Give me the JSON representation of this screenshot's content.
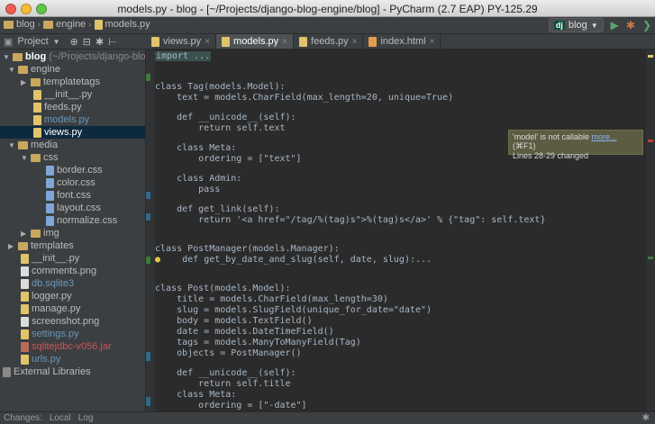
{
  "window": {
    "title": "models.py - blog - [~/Projects/django-blog-engine/blog] - PyCharm (2.7 EAP) PY-125.29"
  },
  "breadcrumbs": [
    "blog",
    "engine",
    "models.py"
  ],
  "run_config": {
    "label": "blog",
    "badge": "dj"
  },
  "project_panel": {
    "label": "Project"
  },
  "tabs": [
    {
      "label": "views.py",
      "icon": "python-file-icon"
    },
    {
      "label": "models.py",
      "icon": "python-file-icon",
      "active": true
    },
    {
      "label": "feeds.py",
      "icon": "python-file-icon"
    },
    {
      "label": "index.html",
      "icon": "html-file-icon"
    }
  ],
  "tree": [
    {
      "label": "blog",
      "path": "(~/Projects/django-blog",
      "type": "root"
    },
    {
      "label": "engine",
      "type": "folder",
      "open": true
    },
    {
      "label": "templatetags",
      "type": "folder"
    },
    {
      "label": "__init__.py",
      "type": "py"
    },
    {
      "label": "feeds.py",
      "type": "py"
    },
    {
      "label": "models.py",
      "type": "py"
    },
    {
      "label": "views.py",
      "type": "py",
      "selected": true
    },
    {
      "label": "media",
      "type": "folder",
      "open": true
    },
    {
      "label": "css",
      "type": "folder",
      "open": true
    },
    {
      "label": "border.css",
      "type": "css"
    },
    {
      "label": "color.css",
      "type": "css"
    },
    {
      "label": "font.css",
      "type": "css"
    },
    {
      "label": "layout.css",
      "type": "css"
    },
    {
      "label": "normalize.css",
      "type": "css"
    },
    {
      "label": "img",
      "type": "folder"
    },
    {
      "label": "templates",
      "type": "folder"
    },
    {
      "label": "__init__.py",
      "type": "py"
    },
    {
      "label": "comments.png",
      "type": "img"
    },
    {
      "label": "db.sqlite3",
      "type": "db"
    },
    {
      "label": "logger.py",
      "type": "py"
    },
    {
      "label": "manage.py",
      "type": "py"
    },
    {
      "label": "screenshot.png",
      "type": "img"
    },
    {
      "label": "settings.py",
      "type": "py"
    },
    {
      "label": "sqlitejdbc-v056.jar",
      "type": "jar"
    },
    {
      "label": "urls.py",
      "type": "py"
    },
    {
      "label": "External Libraries",
      "type": "lib"
    }
  ],
  "code": [
    "import ...",
    "",
    "",
    "class Tag(models.Model):",
    "    text = models.CharField(max_length=20, unique=True)",
    "",
    "    def __unicode__(self):",
    "        return self.text",
    "",
    "    class Meta:",
    "        ordering = [\"text\"]",
    "",
    "    class Admin:",
    "        pass",
    "",
    "    def get_link(self):",
    "        return '<a href=\"/tag/%(tag)s\">%(tag)s</a>' % {\"tag\": self.text}",
    "",
    "",
    "class PostManager(models.Manager):",
    "    def get_by_date_and_slug(self, date, slug):...",
    "",
    "",
    "class Post(models.Model):",
    "    title = models.CharField(max_length=30)",
    "    slug = models.SlugField(unique_for_date=\"date\")",
    "    body = models.TextField()",
    "    date = models.DateTimeField()",
    "    tags = models.ManyToManyField(Tag)",
    "    objects = PostManager()",
    "",
    "    def __unicode__(self):",
    "        return self.title",
    "",
    "    class Meta:",
    "        ordering = [\"-date\"]"
  ],
  "tooltip": {
    "message": "'model' is not callable",
    "link": "more...",
    "shortcut": "(⌘F1)",
    "changes": "Lines 28-29 changed"
  },
  "status": {
    "changes": "Changes:",
    "local": "Local",
    "log": "Log"
  }
}
